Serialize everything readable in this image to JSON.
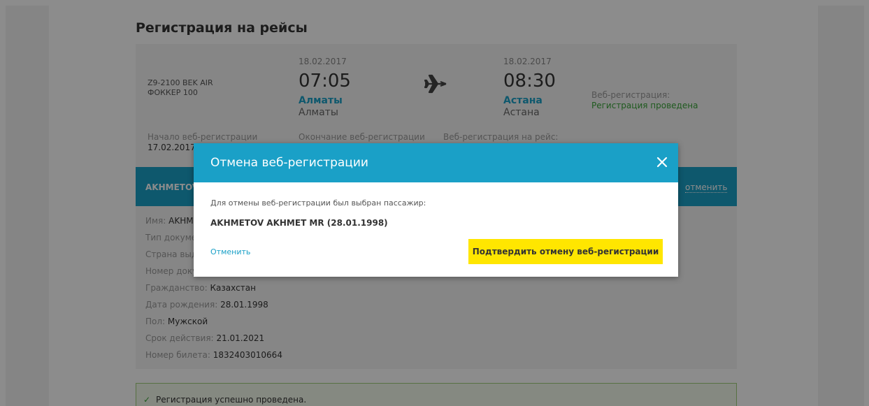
{
  "page": {
    "title": "Регистрация на рейсы"
  },
  "flight": {
    "name_line1": "Z9-2100 BEK AIR",
    "name_line2": "ФОККЕР 100",
    "departure": {
      "date": "18.02.2017",
      "time": "07:05",
      "city": "Алматы",
      "airport": "Алматы"
    },
    "arrival": {
      "date": "18.02.2017",
      "time": "08:30",
      "city": "Астана",
      "airport": "Астана"
    },
    "web_reg_label": "Веб-регистрация:",
    "web_reg_status": "Регистрация проведена",
    "reg_start_label": "Начало веб-регистрации",
    "reg_start_value": "17.02.2017",
    "reg_end_label": "Окончание веб-регистрации",
    "reg_flight_label": "Веб-регистрация на рейс:"
  },
  "passenger_bar": {
    "name": "AKHMETOV",
    "cancel_label": "отменить"
  },
  "passenger_info": [
    {
      "label": "Имя:",
      "value": "AKHM"
    },
    {
      "label": "Тип докуме",
      "value": ""
    },
    {
      "label": "Страна выд",
      "value": ""
    },
    {
      "label": "Номер доку",
      "value": ""
    },
    {
      "label": "Гражданство:",
      "value": "Казахстан"
    },
    {
      "label": "Дата рождения:",
      "value": "28.01.1998"
    },
    {
      "label": "Пол:",
      "value": "Мужской"
    },
    {
      "label": "Срок действия:",
      "value": "21.01.2021"
    },
    {
      "label": "Номер билета:",
      "value": "1832403010664"
    }
  ],
  "success": {
    "text": "Регистрация успешно проведена."
  },
  "modal": {
    "title": "Отмена веб-регистрации",
    "description": "Для отмены веб-регистрации был выбран пассажир:",
    "passenger": "AKHMETOV AKHMET MR (28.01.1998)",
    "cancel_link": "Отменить",
    "confirm_button": "Подтвердить отмену веб-регистрации"
  },
  "colors": {
    "accent": "#1aa0c7",
    "confirm": "#ffe600",
    "success": "#3aa53a"
  }
}
